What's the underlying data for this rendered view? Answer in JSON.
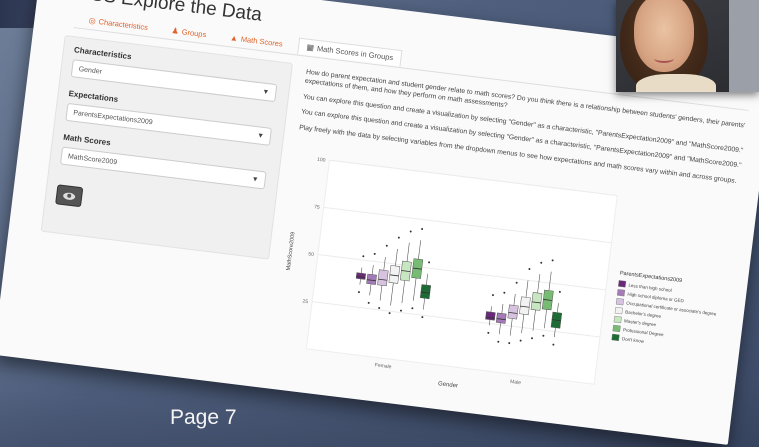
{
  "app": {
    "title": "NISS Explore the Data"
  },
  "tabs": [
    {
      "label": "Characteristics",
      "icon": "target-icon"
    },
    {
      "label": "Groups",
      "icon": "person-icon"
    },
    {
      "label": "Math Scores",
      "icon": "fire-icon"
    },
    {
      "label": "Math Scores in Groups",
      "icon": "table-icon",
      "active": true
    }
  ],
  "sidebar": {
    "characteristics": {
      "label": "Characteristics",
      "value": "Gender"
    },
    "expectations": {
      "label": "Expectations",
      "value": "ParentsExpectations2009"
    },
    "math_scores": {
      "label": "Math Scores",
      "value": "MathScore2009"
    }
  },
  "main": {
    "paragraphs": [
      "How do parent expectation and student gender relate to math scores? Do you think there is a relationship between students' genders, their parents' expectations of them, and how they perform on math assessments?",
      "You can explore this question and create a visualization by selecting \"Gender\" as a characteristic, \"ParentsExpectation2009\" and \"MathScore2009.\"",
      "You can explore this question and create a visualization by selecting \"Gender\" as a characteristic, \"ParentsExpectation2009\" and \"MathScore2009.\"",
      "Play freely with the data by selecting variables from the dropdown menus to see how expectations and math scores vary within and across groups."
    ]
  },
  "chart_data": {
    "type": "boxplot",
    "xlabel": "Gender",
    "ylabel": "MathScore2009",
    "ylim": [
      0,
      100
    ],
    "yticks": [
      "100",
      "75",
      "50",
      "25"
    ],
    "categories": [
      "Female",
      "Male"
    ],
    "legend_title": "ParentsExpectations2009",
    "series": [
      {
        "name": "Less than high school",
        "color": "#6a2a7a",
        "female": [
          37,
          40,
          41,
          43,
          46
        ],
        "male": [
          24,
          27,
          28,
          31,
          34
        ]
      },
      {
        "name": "High school diploma or GED",
        "color": "#a57ab8",
        "female": [
          32,
          38,
          40,
          43,
          48
        ],
        "male": [
          20,
          26,
          28,
          31,
          36
        ]
      },
      {
        "name": "Occupational certificate or associate's degree",
        "color": "#d7c3df",
        "female": [
          30,
          38,
          41,
          46,
          53
        ],
        "male": [
          20,
          29,
          32,
          36,
          42
        ]
      },
      {
        "name": "Bachelor's degree",
        "color": "#f2f2f2",
        "female": [
          28,
          40,
          44,
          49,
          58
        ],
        "male": [
          22,
          32,
          36,
          41,
          50
        ]
      },
      {
        "name": "Master's degree",
        "color": "#c9e6c2",
        "female": [
          30,
          42,
          47,
          52,
          62
        ],
        "male": [
          24,
          35,
          39,
          44,
          54
        ]
      },
      {
        "name": "Professional Degree",
        "color": "#78bb74",
        "female": [
          32,
          44,
          49,
          54,
          64
        ],
        "male": [
          26,
          36,
          41,
          46,
          56
        ]
      },
      {
        "name": "Don't know",
        "color": "#1f6b35",
        "female": [
          28,
          34,
          37,
          41,
          47
        ],
        "male": [
          22,
          27,
          31,
          35,
          40
        ]
      }
    ]
  },
  "slide": {
    "page_label": "Page 7"
  }
}
